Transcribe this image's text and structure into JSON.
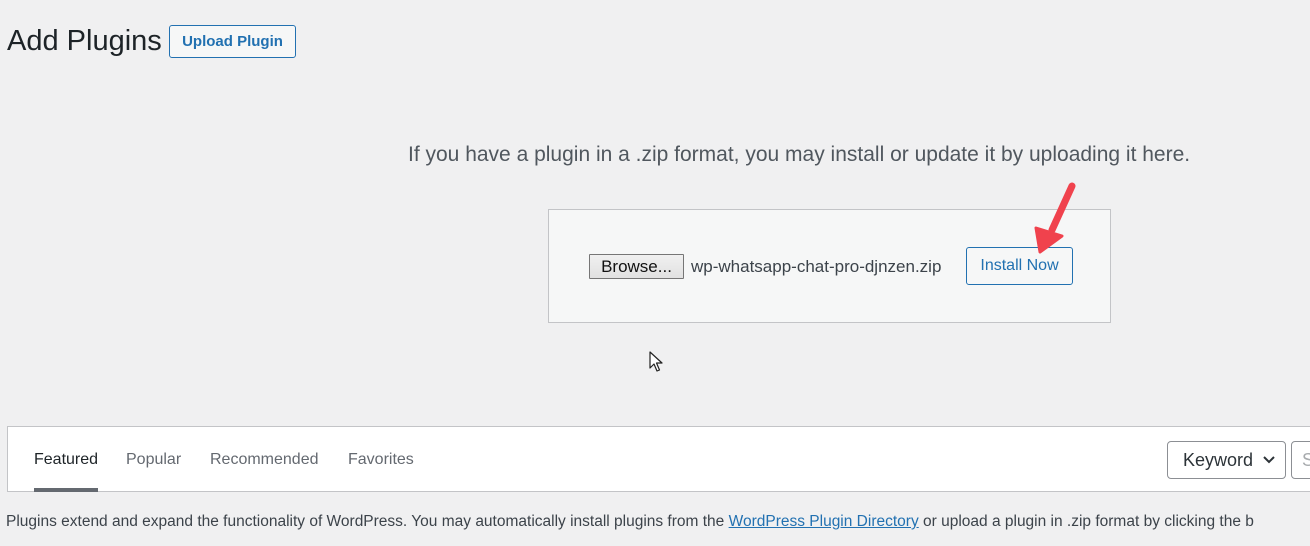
{
  "header": {
    "title": "Add Plugins",
    "upload_button": "Upload Plugin"
  },
  "upload": {
    "help_text": "If you have a plugin in a .zip format, you may install or update it by uploading it here.",
    "browse_label": "Browse...",
    "file_name": "wp-whatsapp-chat-pro-djnzen.zip",
    "install_label": "Install Now"
  },
  "filters": {
    "tabs": [
      {
        "label": "Featured",
        "current": true
      },
      {
        "label": "Popular"
      },
      {
        "label": "Recommended"
      },
      {
        "label": "Favorites"
      }
    ],
    "search_type": "Keyword",
    "search_placeholder": "S"
  },
  "intro": {
    "before": "Plugins extend and expand the functionality of WordPress. You may automatically install plugins from the ",
    "link": "WordPress Plugin Directory",
    "after": " or upload a plugin in .zip format by clicking the b"
  },
  "colors": {
    "accent": "#2271b1",
    "annotation_arrow": "#f0424d"
  }
}
